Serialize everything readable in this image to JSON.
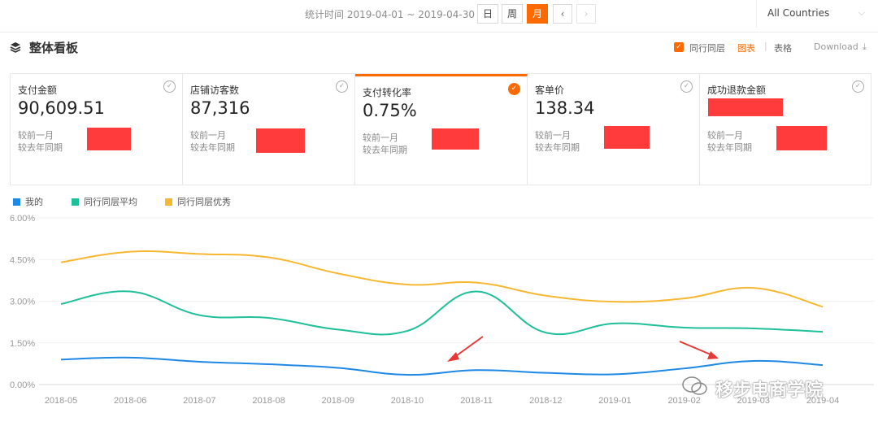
{
  "topbar": {
    "stat_time": "统计时间 2019-04-01 ~ 2019-04-30",
    "periods": [
      "日",
      "周",
      "月"
    ],
    "active_period": "月",
    "prev_label": "‹",
    "next_label": "›",
    "country": "All Countries",
    "country_chevron": "⌵"
  },
  "section": {
    "icon": "layers-icon",
    "title": "整体看板",
    "peer_label": "同行同层",
    "peer_checked": true,
    "tab_chart": "图表",
    "tab_sep": "|",
    "tab_table": "表格",
    "download": "Download",
    "download_icon": "⤓"
  },
  "cards": [
    {
      "title": "支付金额",
      "value": "90,609.51",
      "cmp_month": "较前一月",
      "cmp_year": "较去年同期",
      "selected": false
    },
    {
      "title": "店铺访客数",
      "value": "87,316",
      "cmp_month": "较前一月",
      "cmp_year": "较去年同期",
      "selected": false
    },
    {
      "title": "支付转化率",
      "value": "0.75%",
      "cmp_month": "较前一月",
      "cmp_year": "较去年同期",
      "selected": true
    },
    {
      "title": "客单价",
      "value": "138.34",
      "cmp_month": "较前一月",
      "cmp_year": "较去年同期",
      "selected": false
    },
    {
      "title": "成功退款金额",
      "value": "",
      "cmp_month": "较前一月",
      "cmp_year": "较去年同期",
      "selected": false
    }
  ],
  "check_glyph": "✓",
  "colors": {
    "accent": "#ff6a00",
    "mine": "#1e88e5",
    "peer_avg": "#1fbf9a",
    "peer_best": "#f7b731",
    "redaction": "#ff3b3b"
  },
  "chart_data": {
    "type": "line",
    "categories": [
      "2018-05",
      "2018-06",
      "2018-07",
      "2018-08",
      "2018-09",
      "2018-10",
      "2018-11",
      "2018-12",
      "2019-01",
      "2019-02",
      "2019-03",
      "2019-04"
    ],
    "y_ticks": [
      "0.00%",
      "1.50%",
      "3.00%",
      "4.50%",
      "6.00%"
    ],
    "ylim": [
      0,
      6
    ],
    "grid": true,
    "legend_position": "top-left",
    "series": [
      {
        "name": "我的",
        "color": "#1e88e5",
        "values": [
          0.9,
          0.97,
          0.82,
          0.73,
          0.6,
          0.35,
          0.52,
          0.42,
          0.37,
          0.58,
          0.85,
          0.7
        ]
      },
      {
        "name": "同行同层平均",
        "color": "#1fbf9a",
        "values": [
          2.9,
          3.35,
          2.5,
          2.4,
          1.98,
          1.93,
          3.35,
          1.87,
          2.2,
          2.05,
          2.02,
          1.9
        ]
      },
      {
        "name": "同行同层优秀",
        "color": "#f7b731",
        "values": [
          4.4,
          4.78,
          4.7,
          4.58,
          4.0,
          3.6,
          3.67,
          3.2,
          2.98,
          3.1,
          3.48,
          2.8
        ]
      }
    ]
  },
  "watermark": "移步电商学院"
}
